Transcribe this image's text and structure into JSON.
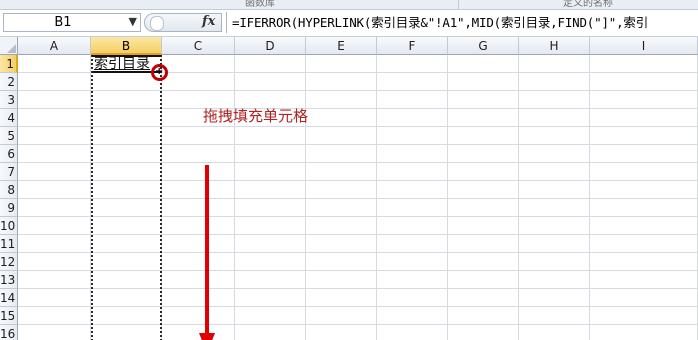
{
  "ribbon": {
    "group_left": "函数库",
    "group_right": "定义的名称"
  },
  "formula_bar": {
    "name_box": "B1",
    "fx_label": "fx",
    "formula": "=IFERROR(HYPERLINK(索引目录&\"!A1\",MID(索引目录,FIND(\"]\",索引"
  },
  "columns": [
    "A",
    "B",
    "C",
    "D",
    "E",
    "F",
    "G",
    "H",
    "I"
  ],
  "selected_column": "B",
  "rows": [
    "1",
    "2",
    "3",
    "4",
    "5",
    "6",
    "7",
    "8",
    "9",
    "10",
    "11",
    "12",
    "13",
    "14",
    "15",
    "16"
  ],
  "selected_row": "1",
  "cells": {
    "B1": "索引目录"
  },
  "annotation": {
    "text": "拖拽填充单元格",
    "color": "#b22222"
  },
  "colors": {
    "selection_header": "#f6cf62",
    "gridline": "#d6dbe3",
    "highlight_circle": "#c00000",
    "arrow": "#e00000"
  }
}
